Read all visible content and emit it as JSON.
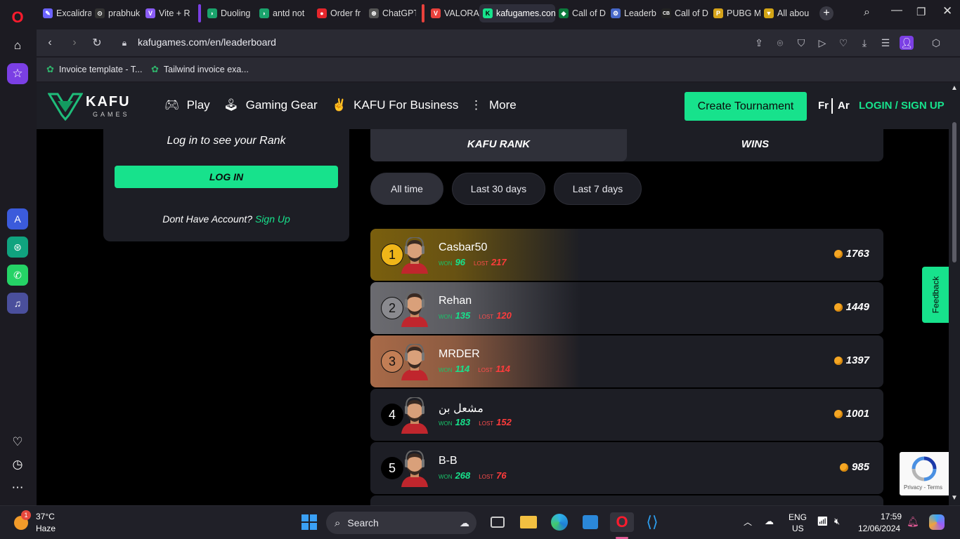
{
  "browser": {
    "tabs": [
      {
        "title": "Excalidra",
        "color": "#6c63ff",
        "glyph": "✎"
      },
      {
        "title": "prabhuk",
        "color": "#333",
        "glyph": "⊙"
      },
      {
        "title": "Vite + R",
        "color": "#8a5cf6",
        "glyph": "V"
      },
      {
        "title": "Duoling",
        "color": "#1aa36c",
        "glyph": "◗"
      },
      {
        "title": "antd not",
        "color": "#1aa36c",
        "glyph": "◗"
      },
      {
        "title": "Order fr",
        "color": "#e4262c",
        "glyph": "●"
      },
      {
        "title": "ChatGPT",
        "color": "#555",
        "glyph": "⊛"
      },
      {
        "title": "VALORA",
        "color": "#e8413c",
        "glyph": "V"
      },
      {
        "title": "kafugames.con",
        "color": "#17e28c",
        "glyph": "K"
      },
      {
        "title": "Call of D",
        "color": "#0c7a3c",
        "glyph": "◆"
      },
      {
        "title": "Leaderb",
        "color": "#4667c8",
        "glyph": "⚙"
      },
      {
        "title": "Call of D",
        "color": "#222",
        "glyph": "CB"
      },
      {
        "title": "PUBG M",
        "color": "#d6a31a",
        "glyph": "P"
      },
      {
        "title": "All abou",
        "color": "#d4a516",
        "glyph": "▼"
      }
    ],
    "url": "kafugames.com/en/leaderboard",
    "bookmarks": [
      {
        "label": "Invoice template - T..."
      },
      {
        "label": "Tailwind invoice exa..."
      }
    ]
  },
  "site": {
    "logo": {
      "name": "KAFU",
      "sub": "GAMES"
    },
    "nav": {
      "play": "Play",
      "gear": "Gaming Gear",
      "business": "KAFU For Business",
      "more": "More"
    },
    "create_tournament": "Create Tournament",
    "lang_fr": "Fr",
    "lang_ar": "Ar",
    "login_signup": "LOGIN / SIGN UP",
    "feedback": "Feedback"
  },
  "login_card": {
    "prompt": "Log in to see your Rank",
    "button": "LOG IN",
    "no_account": "Dont Have Account?",
    "signup": "Sign Up"
  },
  "rank_tabs": {
    "kafu_rank": "KAFU RANK",
    "wins": "WINS"
  },
  "filters": {
    "all_time": "All time",
    "last_30": "Last 30 days",
    "last_7": "Last 7 days"
  },
  "labels": {
    "won": "WON",
    "lost": "LOST"
  },
  "leaderboard": [
    {
      "rank": "1",
      "name": "Casbar50",
      "won": "96",
      "lost": "217",
      "points": "1763",
      "tint": "#7a5f0e",
      "badge": "#f0b619"
    },
    {
      "rank": "2",
      "name": "Rehan",
      "won": "135",
      "lost": "120",
      "points": "1449",
      "tint": "#6b6b70",
      "badge": "#8a8a8f"
    },
    {
      "rank": "3",
      "name": "MRDER",
      "won": "114",
      "lost": "114",
      "points": "1397",
      "tint": "#a86a48",
      "badge": "#c27e55"
    },
    {
      "rank": "4",
      "name": "مشعل بن",
      "won": "183",
      "lost": "152",
      "points": "1001",
      "tint": "",
      "badge": ""
    },
    {
      "rank": "5",
      "name": "B-B",
      "won": "268",
      "lost": "76",
      "points": "985",
      "tint": "",
      "badge": ""
    }
  ],
  "recaptcha": {
    "links": "Privacy - Terms"
  },
  "taskbar": {
    "weather_temp": "37°C",
    "weather_desc": "Haze",
    "weather_badge": "1",
    "search": "Search",
    "lang_top": "ENG",
    "lang_bottom": "US",
    "time": "17:59",
    "date": "12/06/2024"
  }
}
